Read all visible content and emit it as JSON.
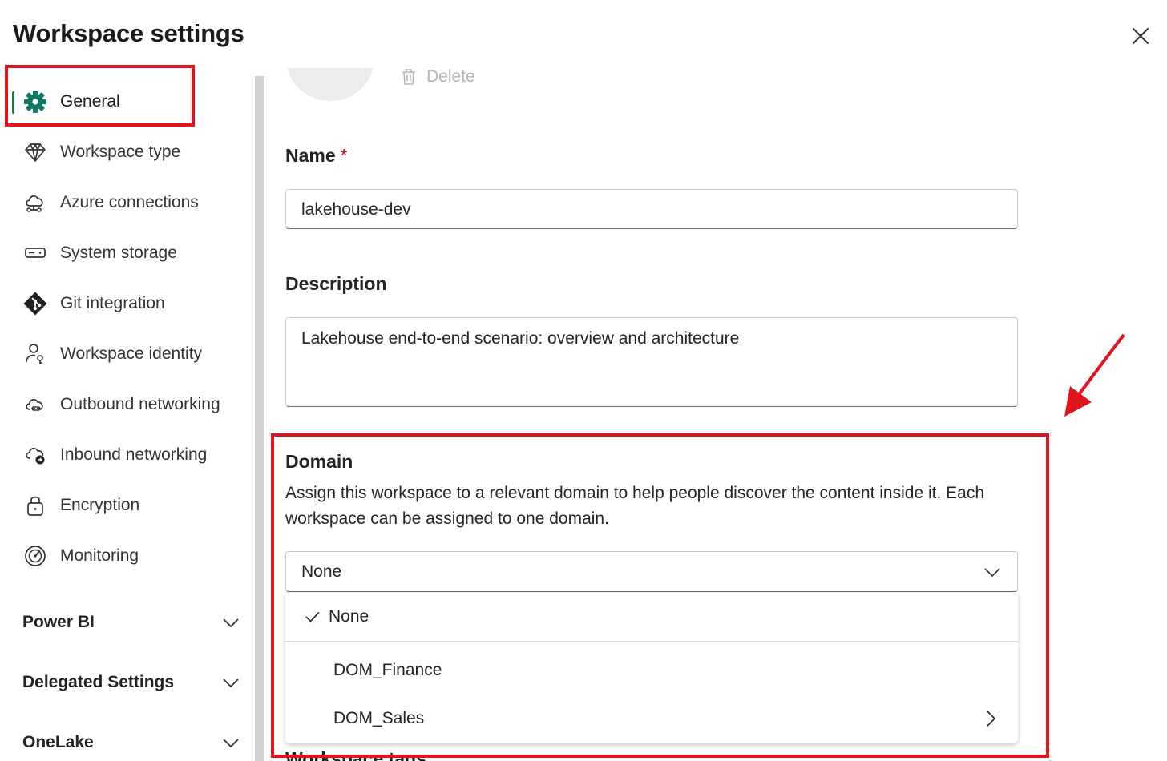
{
  "header": {
    "title": "Workspace settings"
  },
  "sidebar": {
    "items": [
      {
        "label": "General",
        "icon": "gear-icon"
      },
      {
        "label": "Workspace type",
        "icon": "diamond-icon"
      },
      {
        "label": "Azure connections",
        "icon": "cloud-connection-icon"
      },
      {
        "label": "System storage",
        "icon": "storage-icon"
      },
      {
        "label": "Git integration",
        "icon": "git-icon"
      },
      {
        "label": "Workspace identity",
        "icon": "person-key-icon"
      },
      {
        "label": "Outbound networking",
        "icon": "cloud-link-icon"
      },
      {
        "label": "Inbound networking",
        "icon": "cloud-arrow-icon"
      },
      {
        "label": "Encryption",
        "icon": "lock-icon"
      },
      {
        "label": "Monitoring",
        "icon": "gauge-icon"
      }
    ],
    "sections": [
      {
        "label": "Power BI"
      },
      {
        "label": "Delegated Settings"
      },
      {
        "label": "OneLake"
      }
    ]
  },
  "main": {
    "delete_label": "Delete",
    "name": {
      "label": "Name",
      "required_mark": "*",
      "value": "lakehouse-dev"
    },
    "description": {
      "label": "Description",
      "value": "Lakehouse end-to-end scenario: overview and architecture"
    },
    "domain": {
      "label": "Domain",
      "help": "Assign this workspace to a relevant domain to help people discover the content inside it. Each workspace can be assigned to one domain.",
      "selected": "None",
      "options": [
        {
          "label": "None",
          "checked": true
        },
        {
          "label": "DOM_Finance",
          "checked": false
        },
        {
          "label": "DOM_Sales",
          "checked": false,
          "has_submenu": true
        }
      ]
    },
    "next_section_label": "Workspace tags"
  },
  "colors": {
    "accent": "#117865",
    "annotation": "#e0141c",
    "required": "#c50f1f"
  }
}
